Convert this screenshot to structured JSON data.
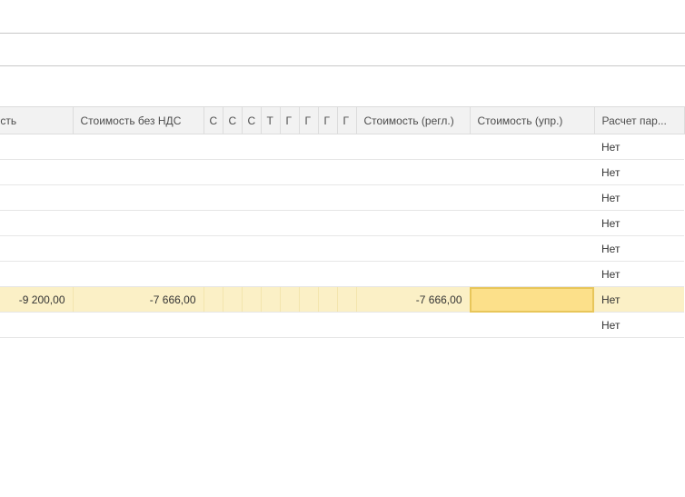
{
  "table": {
    "columns": [
      "Стоимость",
      "Стоимость без НДС",
      "С",
      "С",
      "С",
      "Т",
      "Г",
      "Г",
      "Г",
      "Г",
      "Стоимость (регл.)",
      "Стоимость (упр.)",
      "Расчет пар..."
    ],
    "rows": [
      {
        "stoimost": "",
        "bez_nds": "",
        "regl": "",
        "upr": "",
        "raschet": "Нет"
      },
      {
        "stoimost": "",
        "bez_nds": "",
        "regl": "",
        "upr": "",
        "raschet": "Нет"
      },
      {
        "stoimost": "",
        "bez_nds": "",
        "regl": "",
        "upr": "",
        "raschet": "Нет"
      },
      {
        "stoimost": "",
        "bez_nds": "",
        "regl": "",
        "upr": "",
        "raschet": "Нет"
      },
      {
        "stoimost": "",
        "bez_nds": "",
        "regl": "",
        "upr": "",
        "raschet": "Нет"
      },
      {
        "stoimost": "",
        "bez_nds": "",
        "regl": "",
        "upr": "",
        "raschet": "Нет"
      },
      {
        "stoimost": "-9 200,00",
        "bez_nds": "-7 666,00",
        "regl": "-7 666,00",
        "upr": "",
        "raschet": "Нет"
      },
      {
        "stoimost": "",
        "bez_nds": "",
        "regl": "",
        "upr": "",
        "raschet": "Нет"
      }
    ],
    "selected_row_index": 6,
    "colors": {
      "selected_row": "#fbf0c6",
      "focused_cell": "#fce08a",
      "header_bg": "#f2f2f2"
    }
  }
}
